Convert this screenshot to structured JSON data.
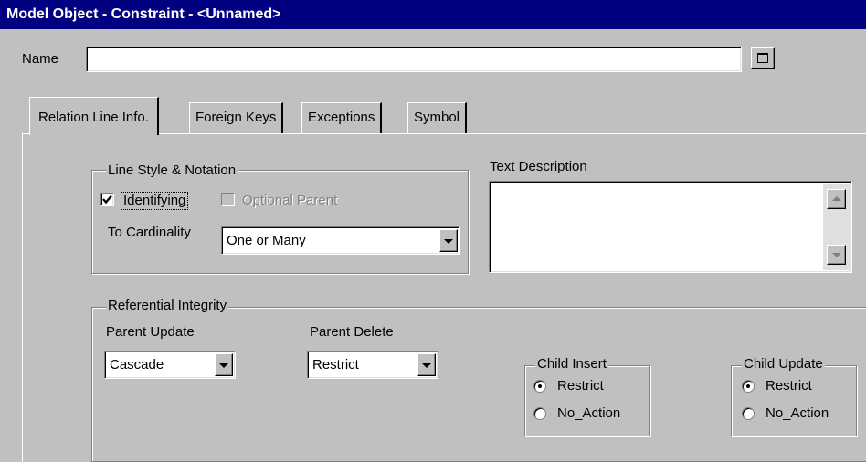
{
  "window": {
    "title": "Model Object - Constraint - <Unnamed>"
  },
  "name_field": {
    "label": "Name",
    "value": ""
  },
  "tabs": [
    {
      "label": "Relation Line Info.",
      "active": true
    },
    {
      "label": "Foreign Keys",
      "active": false
    },
    {
      "label": "Exceptions",
      "active": false
    },
    {
      "label": "Symbol",
      "active": false
    }
  ],
  "line_style": {
    "legend": "Line Style & Notation",
    "identifying": {
      "label": "Identifying",
      "checked": true
    },
    "optional_parent": {
      "label": "Optional Parent",
      "checked": false,
      "enabled": false
    },
    "cardinality": {
      "label": "To Cardinality",
      "value": "One or Many"
    }
  },
  "text_description": {
    "label": "Text Description",
    "value": ""
  },
  "referential_integrity": {
    "legend": "Referential Integrity",
    "parent_update": {
      "label": "Parent Update",
      "value": "Cascade"
    },
    "parent_delete": {
      "label": "Parent Delete",
      "value": "Restrict"
    },
    "child_insert": {
      "legend": "Child Insert",
      "options": [
        "Restrict",
        "No_Action"
      ],
      "selected": "Restrict"
    },
    "child_update": {
      "legend": "Child Update",
      "options": [
        "Restrict",
        "No_Action"
      ],
      "selected": "Restrict"
    }
  },
  "colors": {
    "titlebar": "#000080",
    "face": "#c0c0c0"
  }
}
